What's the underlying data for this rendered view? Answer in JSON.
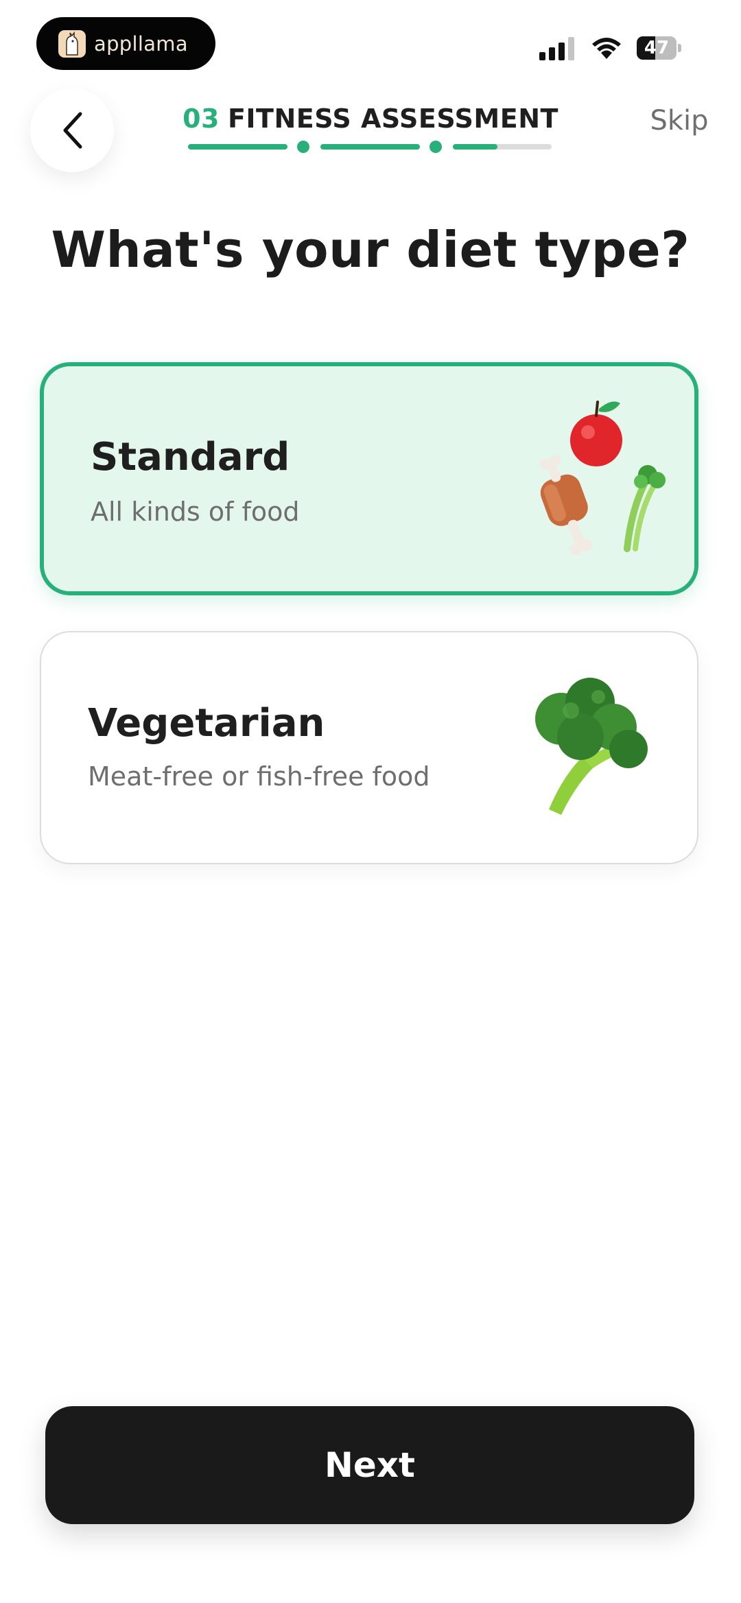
{
  "status_bar": {
    "app_badge_text": "appllama",
    "battery_level": "47",
    "battery_fraction": 0.47
  },
  "header": {
    "step_number": "03",
    "step_name": "FITNESS ASSESSMENT",
    "skip_label": "Skip",
    "progress": {
      "segments_total": 3,
      "segments_complete": 2,
      "current_segment_fill": 0.45
    }
  },
  "question": "What's your diet type?",
  "options": [
    {
      "title": "Standard",
      "subtitle": "All kinds of food",
      "selected": true,
      "illustration": "apple-meat-celery-icon"
    },
    {
      "title": "Vegetarian",
      "subtitle": "Meat-free or fish-free food",
      "selected": false,
      "illustration": "broccoli-icon"
    }
  ],
  "next_label": "Next",
  "colors": {
    "accent": "#27b07a",
    "selected_bg": "#e4f7ec",
    "button_bg": "#1a1a1a",
    "text": "#1f1f1f"
  }
}
